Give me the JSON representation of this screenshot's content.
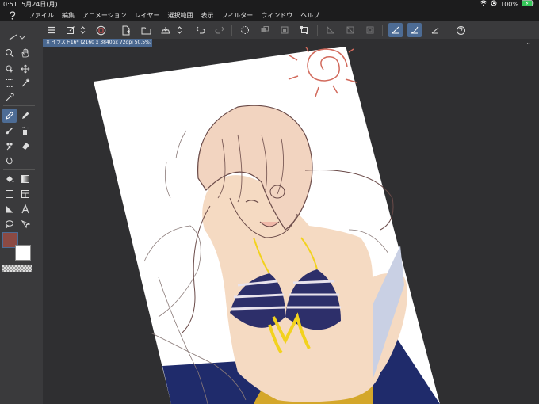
{
  "status": {
    "time": "0:51",
    "date": "5月24日(月)",
    "battery": "100%"
  },
  "menu": {
    "items": [
      "ファイル",
      "編集",
      "アニメーション",
      "レイヤー",
      "選択範囲",
      "表示",
      "フィルター",
      "ウィンドウ",
      "ヘルプ"
    ]
  },
  "document": {
    "tab_title": "イラスト16* (2160 x 3840px 72dpi 50.5%)"
  },
  "colors": {
    "main_color": "#8b4a44",
    "sub_color": "#ffffff",
    "accent": "#4d6c95"
  }
}
